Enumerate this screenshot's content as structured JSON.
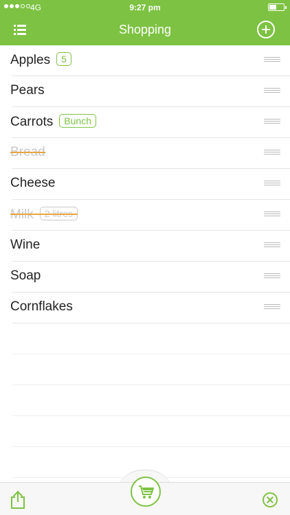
{
  "status_bar": {
    "carrier": "4G",
    "time": "9:27 pm"
  },
  "nav": {
    "title": "Shopping"
  },
  "items": [
    {
      "name": "Apples",
      "badge": "5",
      "done": false
    },
    {
      "name": "Pears",
      "badge": "",
      "done": false
    },
    {
      "name": "Carrots",
      "badge": "Bunch",
      "done": false
    },
    {
      "name": "Bread",
      "badge": "",
      "done": true
    },
    {
      "name": "Cheese",
      "badge": "",
      "done": false
    },
    {
      "name": "Milk",
      "badge": "2 litres",
      "done": true
    },
    {
      "name": "Wine",
      "badge": "",
      "done": false
    },
    {
      "name": "Soap",
      "badge": "",
      "done": false
    },
    {
      "name": "Cornflakes",
      "badge": "",
      "done": false
    }
  ],
  "icons": {
    "menu": "list-icon",
    "add": "plus-circle-icon",
    "share": "share-icon",
    "cart": "cart-icon",
    "close": "close-circle-icon",
    "handle": "drag-handle-icon"
  },
  "colors": {
    "accent": "#7dc242",
    "strike": "#e8a63d",
    "muted": "#c8c8c8"
  }
}
